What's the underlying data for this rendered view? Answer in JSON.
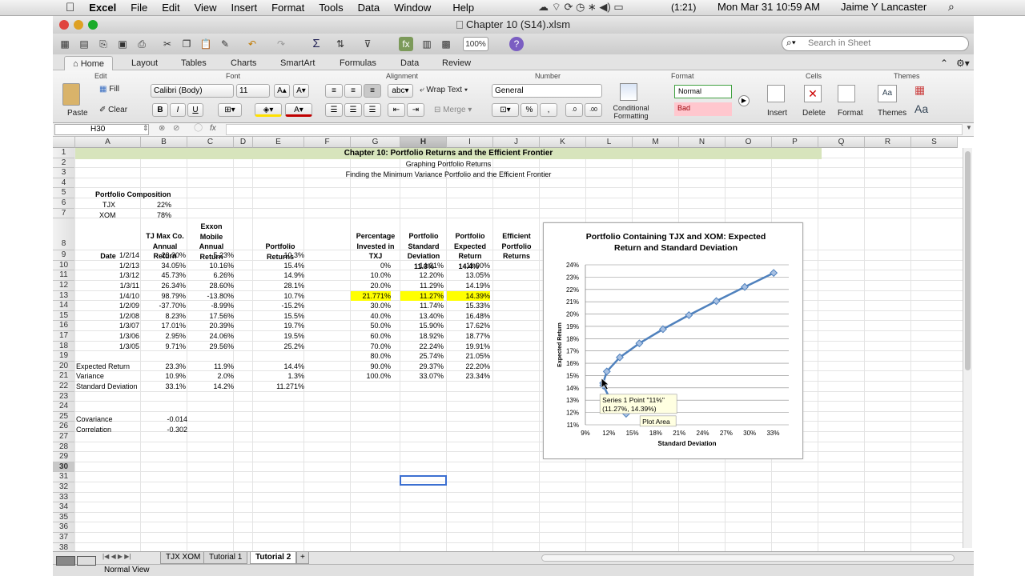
{
  "menubar": {
    "apple": "",
    "app_name": "Excel",
    "items": [
      "File",
      "Edit",
      "View",
      "Insert",
      "Format",
      "Tools",
      "Data",
      "Window",
      "Help"
    ],
    "battery": "(1:21)",
    "datetime": "Mon Mar 31  10:59 AM",
    "user": "Jaime Y Lancaster"
  },
  "window": {
    "title": "Chapter 10 (S14).xlsm"
  },
  "toolbar": {
    "zoom": "100%",
    "search_placeholder": "Search in Sheet"
  },
  "ribbon_tabs": [
    "Home",
    "Layout",
    "Tables",
    "Charts",
    "SmartArt",
    "Formulas",
    "Data",
    "Review"
  ],
  "ribbon": {
    "groups": [
      "Edit",
      "Font",
      "Alignment",
      "Number",
      "Format",
      "Cells",
      "Themes"
    ],
    "paste": "Paste",
    "fill": "Fill",
    "clear": "Clear",
    "font_name": "Calibri (Body)",
    "font_size": "11",
    "bold": "B",
    "italic": "I",
    "underline": "U",
    "wrap_text": "Wrap Text",
    "merge": "Merge",
    "number_format": "General",
    "percent": "%",
    "comma": ",",
    "cond_format": "Conditional Formatting",
    "style_normal": "Normal",
    "style_bad": "Bad",
    "insert": "Insert",
    "delete": "Delete",
    "format": "Format",
    "themes": "Themes",
    "aa_small": "Aa",
    "aa_big": "Aa"
  },
  "formula_bar": {
    "name_box": "H30",
    "fx": "fx",
    "content": ""
  },
  "columns": [
    "A",
    "B",
    "C",
    "D",
    "E",
    "F",
    "G",
    "H",
    "I",
    "J",
    "K",
    "L",
    "M",
    "N",
    "O",
    "P",
    "Q",
    "R",
    "S"
  ],
  "rows": [
    "1",
    "2",
    "3",
    "4",
    "5",
    "6",
    "7",
    "8",
    "9",
    "10",
    "11",
    "12",
    "13",
    "14",
    "15",
    "16",
    "17",
    "18",
    "19",
    "20",
    "21",
    "22",
    "23",
    "24",
    "25",
    "26",
    "27",
    "28",
    "29",
    "30",
    "31",
    "32",
    "33",
    "34",
    "35",
    "36",
    "37",
    "38"
  ],
  "sheet": {
    "title": "Chapter 10: Portfolio Returns and the Efficient Frontier",
    "subtitle1": "Graphing Portfolio Returns",
    "subtitle2": "Finding the Minimum Variance Portfolio and the Efficient Frontier",
    "composition_label": "Portfolio Composition",
    "tjx_label": "TJX",
    "tjx_pct": "22%",
    "xom_label": "XOM",
    "xom_pct": "78%",
    "hdr_date": "Date",
    "hdr_tjx": "TJ Max Co. Annual Return",
    "hdr_xom": "Exxon Mobile Annual Return",
    "hdr_port": "Portfolio Returns",
    "hdr_pct": "Percentage Invested in TXJ",
    "hdr_std": "Portfolio Standard Deviation",
    "hdr_exp": "Portfolio Expected Return",
    "hdr_eff": "Efficient Portfolio Returns",
    "data_rows": [
      [
        "1/2/14",
        "28.30%",
        "5.23%",
        "10.3%"
      ],
      [
        "1/2/13",
        "34.05%",
        "10.16%",
        "15.4%"
      ],
      [
        "1/3/12",
        "45.73%",
        "6.26%",
        "14.9%"
      ],
      [
        "1/3/11",
        "26.34%",
        "28.60%",
        "28.1%"
      ],
      [
        "1/4/10",
        "98.79%",
        "-13.80%",
        "10.7%"
      ],
      [
        "1/2/09",
        "-37.70%",
        "-8.99%",
        "-15.2%"
      ],
      [
        "1/2/08",
        "8.23%",
        "17.56%",
        "15.5%"
      ],
      [
        "1/3/07",
        "17.01%",
        "20.39%",
        "19.7%"
      ],
      [
        "1/3/06",
        "2.95%",
        "24.06%",
        "19.5%"
      ],
      [
        "1/3/05",
        "9.71%",
        "29.56%",
        "25.2%"
      ]
    ],
    "frontier_top": [
      "11.3%",
      "14.4%"
    ],
    "frontier_rows": [
      [
        "0%",
        "14.21%",
        "11.90%"
      ],
      [
        "10.0%",
        "12.20%",
        "13.05%"
      ],
      [
        "20.0%",
        "11.29%",
        "14.19%"
      ],
      [
        "21.771%",
        "11.27%",
        "14.39%"
      ],
      [
        "30.0%",
        "11.74%",
        "15.33%"
      ],
      [
        "40.0%",
        "13.40%",
        "16.48%"
      ],
      [
        "50.0%",
        "15.90%",
        "17.62%"
      ],
      [
        "60.0%",
        "18.92%",
        "18.77%"
      ],
      [
        "70.0%",
        "22.24%",
        "19.91%"
      ],
      [
        "80.0%",
        "25.74%",
        "21.05%"
      ],
      [
        "90.0%",
        "29.37%",
        "22.20%"
      ],
      [
        "100.0%",
        "33.07%",
        "23.34%"
      ]
    ],
    "stats": [
      [
        "Expected Return",
        "23.3%",
        "11.9%",
        "14.4%"
      ],
      [
        "Variance",
        "10.9%",
        "2.0%",
        "1.3%"
      ],
      [
        "Standard Deviation",
        "33.1%",
        "14.2%",
        "11.271%"
      ]
    ],
    "covariance_label": "Covariance",
    "covariance": "-0.014",
    "correlation_label": "Correlation",
    "correlation": "-0.302"
  },
  "chart_data": {
    "type": "scatter",
    "title": "Portfolio Containing TJX and XOM: Expected Return and Standard Deviation",
    "xlabel": "Standard Deviation",
    "ylabel": "Expected Return",
    "xlim": [
      9,
      35
    ],
    "ylim": [
      11,
      24
    ],
    "xticks": [
      "9%",
      "12%",
      "15%",
      "18%",
      "21%",
      "24%",
      "27%",
      "30%",
      "33%"
    ],
    "yticks": [
      "11%",
      "12%",
      "13%",
      "14%",
      "15%",
      "16%",
      "17%",
      "18%",
      "19%",
      "20%",
      "21%",
      "22%",
      "23%",
      "24%"
    ],
    "series": [
      {
        "name": "Series 1",
        "x": [
          14.21,
          12.2,
          11.29,
          11.27,
          11.74,
          13.4,
          15.9,
          18.92,
          22.24,
          25.74,
          29.37,
          33.07
        ],
        "y": [
          11.9,
          13.05,
          14.19,
          14.39,
          15.33,
          16.48,
          17.62,
          18.77,
          19.91,
          21.05,
          22.2,
          23.34
        ]
      }
    ],
    "tooltip_line1": "Series 1 Point \"11%\"",
    "tooltip_line2": "(11.27%, 14.39%)",
    "tooltip_plot": "Plot Area",
    "color": "#4f81bd"
  },
  "sheet_tabs": [
    "TJX XOM",
    "Tutorial 1",
    "Tutorial 2"
  ],
  "sheet_tab_add": "+",
  "sheet_nav": "|◀ ◀ ▶ ▶|",
  "status": {
    "view": "Normal View"
  }
}
